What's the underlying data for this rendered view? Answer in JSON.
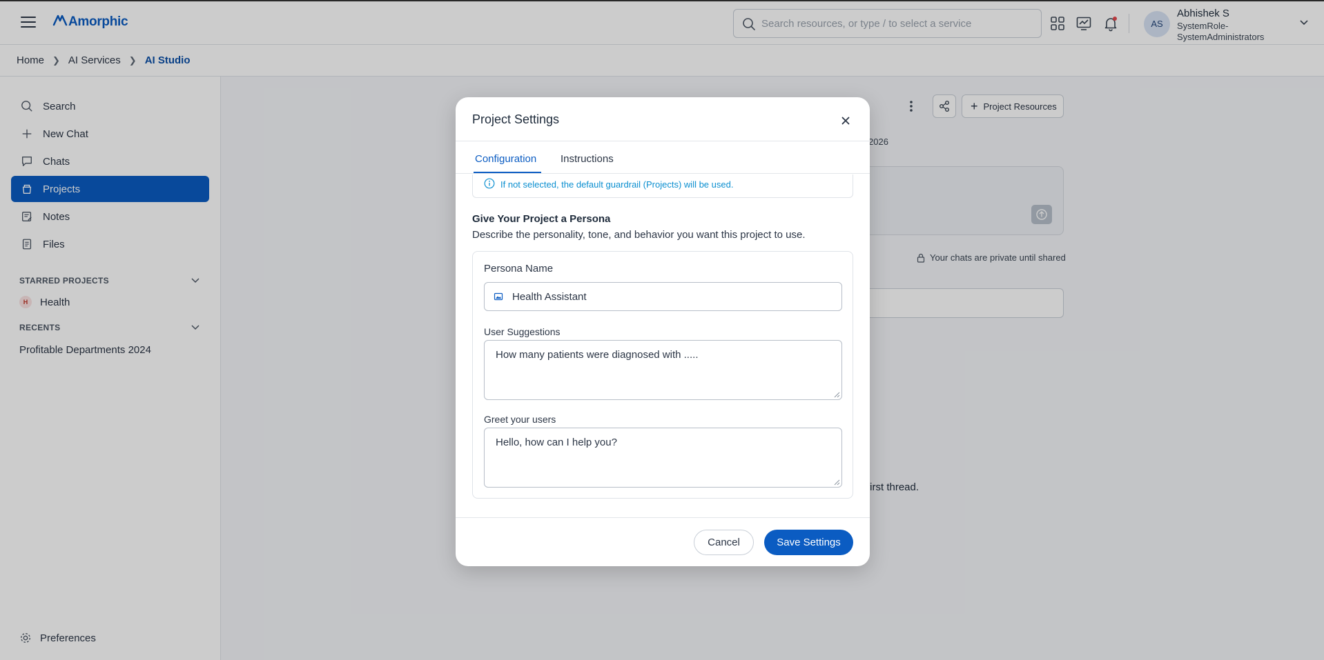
{
  "app": {
    "logo_text": "Amorphic",
    "brand_color": "#0b5cc2"
  },
  "topbar": {
    "search_placeholder": "Search resources, or type / to select a service",
    "icons": [
      "apps-grid-icon",
      "monitor-chart-icon",
      "notification-bell-icon"
    ],
    "user": {
      "initials": "AS",
      "name": "Abhishek S",
      "role": "SystemRole-SystemAdministrators"
    }
  },
  "breadcrumb": {
    "items": [
      "Home",
      "AI Services"
    ],
    "current": "AI Studio"
  },
  "sidebar": {
    "items": [
      {
        "label": "Search",
        "icon": "search-icon"
      },
      {
        "label": "New Chat",
        "icon": "plus-icon"
      },
      {
        "label": "Chats",
        "icon": "chat-bubble-icon"
      },
      {
        "label": "Projects",
        "icon": "projects-icon",
        "active": true
      },
      {
        "label": "Notes",
        "icon": "notes-icon"
      },
      {
        "label": "Files",
        "icon": "file-icon"
      }
    ],
    "starred_title": "STARRED PROJECTS",
    "starred": [
      {
        "badge": "H",
        "label": "Health"
      }
    ],
    "recents_title": "RECENTS",
    "recents": [
      "Profitable Departments 2024"
    ],
    "preferences": "Preferences"
  },
  "main_bg": {
    "resources_button": "Project Resources",
    "date_fragment": "2026",
    "private_note": "Your chats are private until shared",
    "thread_fragment": "first thread."
  },
  "modal": {
    "title": "Project Settings",
    "tabs": [
      {
        "label": "Configuration",
        "active": true
      },
      {
        "label": "Instructions",
        "active": false
      }
    ],
    "guardrail_note": "If not selected, the default guardrail (Projects) will be used.",
    "persona_heading": "Give Your Project a Persona",
    "persona_description": "Describe the personality, tone, and behavior you want this project to use.",
    "persona_name_label": "Persona Name",
    "persona_name_value": "Health Assistant",
    "user_suggestions_label": "User Suggestions",
    "user_suggestions_value": "How many patients were diagnosed with .....",
    "greet_label": "Greet your users",
    "greet_value": "Hello, how can I help you?",
    "cancel_label": "Cancel",
    "save_label": "Save Settings"
  }
}
